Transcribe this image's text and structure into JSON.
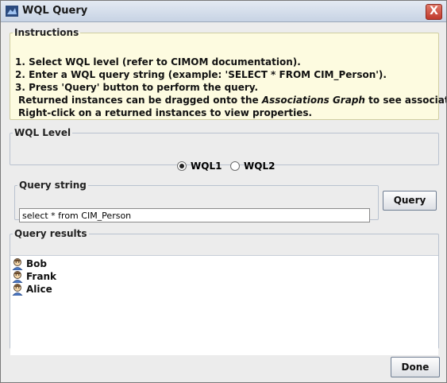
{
  "window": {
    "title": "WQL Query",
    "close_label": "X"
  },
  "instructions": {
    "legend": "Instructions",
    "lines": [
      "1. Select WQL level (refer to CIMOM documentation).",
      "2. Enter a WQL query string (example: 'SELECT * FROM CIM_Person').",
      "3. Press 'Query' button to perform the query."
    ],
    "drag_pre": "Returned instances can be dragged onto the",
    "drag_em": "Associations Graph",
    "drag_post": "to see associations.",
    "right_click": "Right-click on a returned instances to view properties."
  },
  "wql_level": {
    "legend": "WQL Level",
    "options": [
      {
        "label": "WQL1",
        "checked": true
      },
      {
        "label": "WQL2",
        "checked": false
      }
    ]
  },
  "query": {
    "legend": "Query string",
    "value": "select * from CIM_Person",
    "button_label": "Query"
  },
  "results": {
    "legend": "Query results",
    "items": [
      {
        "name": "Bob",
        "icon": "person-icon"
      },
      {
        "name": "Frank",
        "icon": "person-icon"
      },
      {
        "name": "Alice",
        "icon": "person-icon"
      }
    ]
  },
  "footer": {
    "done_label": "Done"
  }
}
